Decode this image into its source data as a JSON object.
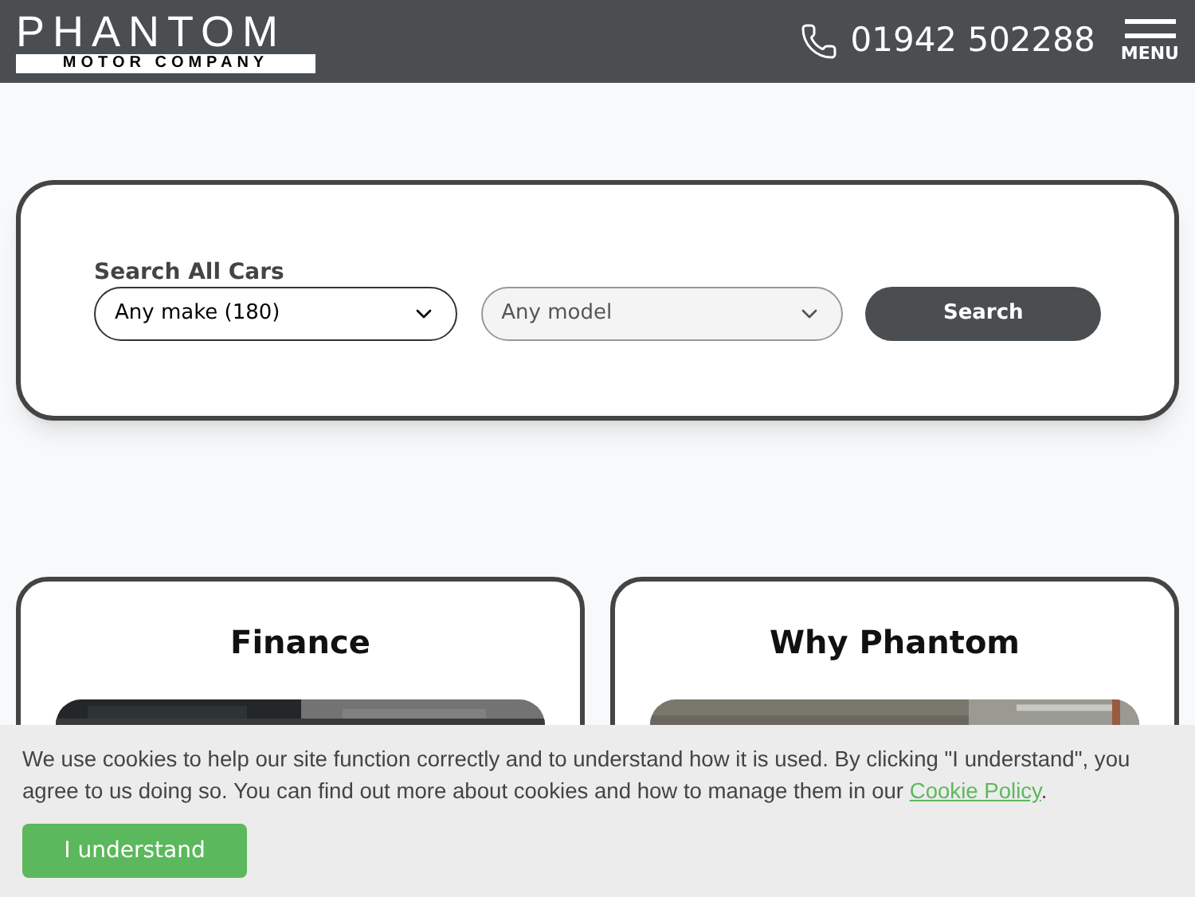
{
  "header": {
    "logo_title": "PHANTOM",
    "logo_subtitle": "MOTOR COMPANY",
    "phone": "01942 502288",
    "menu_label": "MENU"
  },
  "search": {
    "title": "Search All Cars",
    "make": "Any make (180)",
    "model": "Any model",
    "button": "Search"
  },
  "cards": [
    {
      "title": "Finance"
    },
    {
      "title": "Why Phantom"
    }
  ],
  "cookie_banner": {
    "text": "We use cookies to help our site function correctly and to understand how it is used. By clicking \"I understand\", you agree to us doing so. You can find out more about cookies and how to manage them in our ",
    "link": "Cookie Policy",
    "after": ".",
    "button": "I understand"
  }
}
